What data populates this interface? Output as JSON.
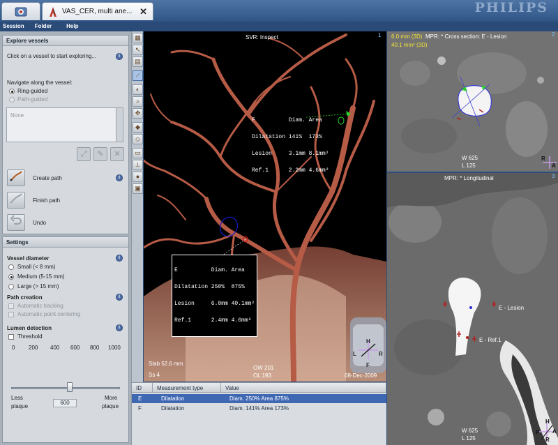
{
  "app": {
    "tab_title": "VAS_CER, multi ane...",
    "brand": "PHILIPS"
  },
  "menu": [
    "Session",
    "Folder",
    "Help"
  ],
  "explore": {
    "header": "Explore vessels",
    "hint": "Click on a vessel to start exploring...",
    "navigate_label": "Navigate along the vessel:",
    "ring_guided": "Ring-guided",
    "path_guided": "Path-guided",
    "list_item": "None",
    "create_path": "Create path",
    "finish_path": "Finish path",
    "undo": "Undo"
  },
  "settings": {
    "header": "Settings",
    "vessel_diameter": "Vessel diameter",
    "small": "Small (< 8 mm)",
    "medium": "Medium (5-15 mm)",
    "large": "Large (> 15 mm)",
    "selected_diameter": "medium",
    "path_creation": "Path creation",
    "auto_tracking": "Automatic tracking",
    "auto_centering": "Automatic point centering",
    "lumen_detection": "Lumen detection",
    "threshold": "Threshold",
    "ticks": [
      "0",
      "200",
      "400",
      "600",
      "800",
      "1000"
    ],
    "slider_value": 600,
    "less_plaque_1": "Less",
    "less_plaque_2": "plaque",
    "more_plaque_1": "More",
    "more_plaque_2": "plaque"
  },
  "viewport_svr": {
    "title": "SVR:  Inspect",
    "number": "1",
    "slab": "Slab 52.6 mm",
    "ss": "Ss 4",
    "ow": "OW 201",
    "ol": "OL 193",
    "date": "08-Dec-2009",
    "box_f": [
      "F          Diam. Area",
      "Dilatation 141%  173%",
      "Lesion     3.1mm 8.1mm²",
      "Ref.1      2.2mm 4.6mm²"
    ],
    "box_e": [
      "E          Diam. Area",
      "Dilatation 250%  875%",
      "Lesion     6.0mm 40.1mm²",
      "Ref.1      2.4mm 4.6mm²"
    ]
  },
  "viewport_cross": {
    "line1_a": "6.0 mm (3D)",
    "line1_b": "MPR:  * Cross section: E - Lesion",
    "line2": "40.1 mm² (3D)",
    "number": "2",
    "w": "W 625",
    "l": "L 125"
  },
  "viewport_long": {
    "title": "MPR:  * Longitudinal",
    "number": "3",
    "lesion": "E - Lesion",
    "ref": "E - Ref.1",
    "w": "W 625",
    "l": "L 125"
  },
  "orientation": {
    "h": "H",
    "a": "A",
    "r": "R",
    "l": "L",
    "p": "P",
    "f": "F"
  },
  "table": {
    "headers": [
      "ID",
      "Measurement type",
      "Value"
    ],
    "rows": [
      {
        "id": "E",
        "type": "Dilatation",
        "value": "Diam. 250% Area 875%"
      },
      {
        "id": "F",
        "type": "Dilatation",
        "value": "Diam. 141% Area 173%"
      }
    ]
  },
  "colors": {
    "accent": "#3f68b3",
    "annotation_yellow": "#f1e23a"
  }
}
